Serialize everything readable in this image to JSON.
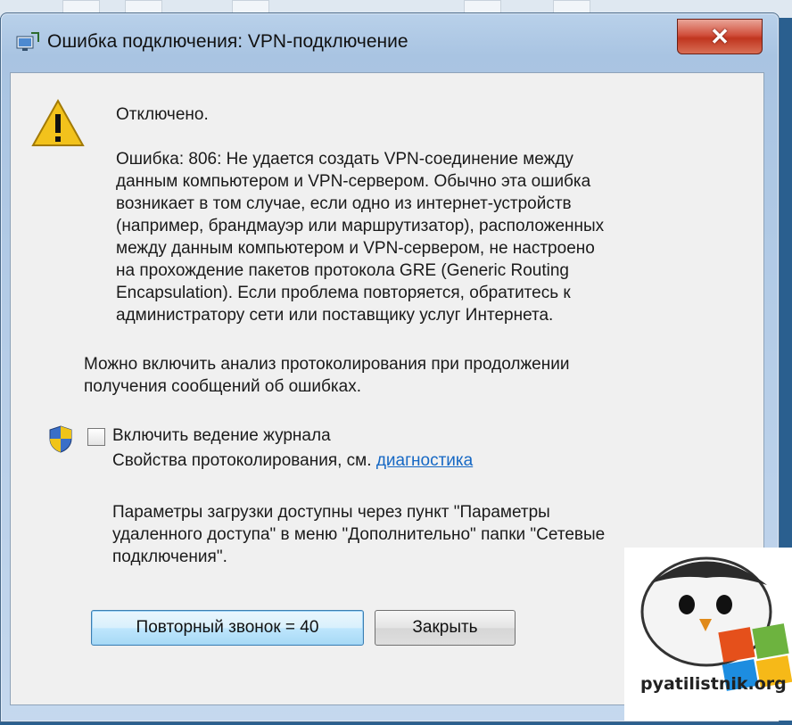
{
  "window": {
    "title": "Ошибка подключения: VPN-подключение",
    "close_glyph": "✕"
  },
  "dialog": {
    "status": "Отключено.",
    "error_lines": [
      "Ошибка: 806: Не удается создать VPN-соединение между",
      "данным компьютером и VPN-сервером. Обычно эта ошибка",
      "возникает в том случае, если одно из интернет-устройств",
      "(например, брандмауэр или маршрутизатор), расположенных",
      "между данным компьютером и VPN-сервером, не настроено",
      "на прохождение пакетов протокола GRE (Generic Routing",
      "Encapsulation). Если проблема повторяется, обратитесь к",
      "администратору сети или поставщику услуг Интернета."
    ],
    "logging_note_lines": [
      "Можно включить анализ протоколирования при продолжении",
      "получения сообщений об ошибках."
    ],
    "checkbox_label": "Включить ведение журнала",
    "checkbox_checked": false,
    "diagnostics_prefix": "Свойства протоколирования, см. ",
    "diagnostics_link": "диагностика",
    "dial_note_lines": [
      "Параметры загрузки доступны через пункт \"Параметры",
      "удаленного доступа\" в меню \"Дополнительно\" папки \"Сетевые",
      "подключения\"."
    ],
    "redial_button": "Повторный звонок = 40",
    "close_button": "Закрыть"
  },
  "watermark": {
    "site": "pyatilistnik.org"
  },
  "icons": {
    "title": "network-connection-icon",
    "warning": "warning-triangle-icon",
    "shield": "uac-shield-icon"
  },
  "colors": {
    "link": "#1668c4",
    "close_button": "#c0351f",
    "default_button": "#3c7fb1"
  }
}
